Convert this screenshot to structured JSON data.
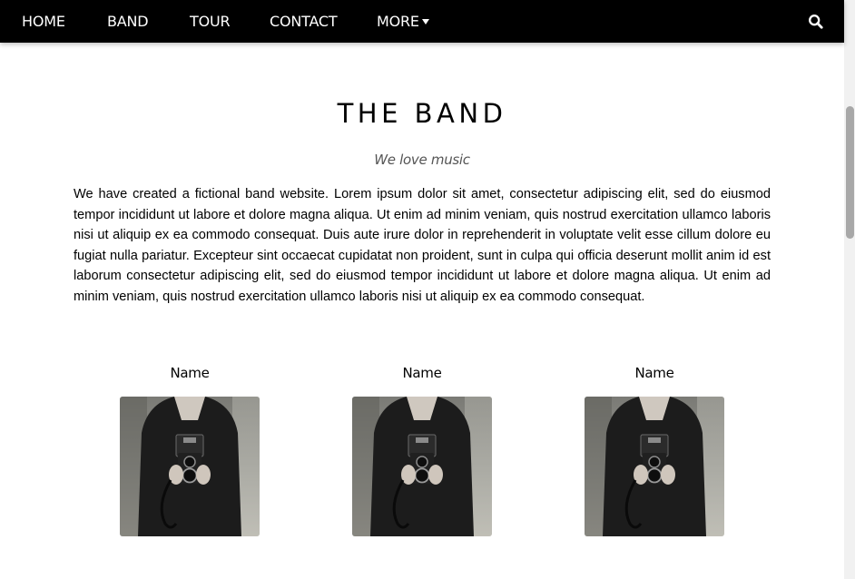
{
  "nav": {
    "items": [
      {
        "label": "HOME"
      },
      {
        "label": "BAND"
      },
      {
        "label": "TOUR"
      },
      {
        "label": "CONTACT"
      },
      {
        "label": "MORE"
      }
    ],
    "search_icon": "search-icon",
    "caret_icon": "caret-down-icon"
  },
  "band_section": {
    "title": "THE BAND",
    "subtitle": "We love music",
    "description": "We have created a fictional band website. Lorem ipsum dolor sit amet, consectetur adipiscing elit, sed do eiusmod tempor incididunt ut labore et dolore magna aliqua. Ut enim ad minim veniam, quis nostrud exercitation ullamco laboris nisi ut aliquip ex ea commodo consequat. Duis aute irure dolor in reprehenderit in voluptate velit esse cillum dolore eu fugiat nulla pariatur. Excepteur sint occaecat cupidatat non proident, sunt in culpa qui officia deserunt mollit anim id est laborum consectetur adipiscing elit, sed do eiusmod tempor incididunt ut labore et dolore magna aliqua. Ut enim ad minim veniam, quis nostrud exercitation ullamco laboris nisi ut aliquip ex ea commodo consequat.",
    "members": [
      {
        "name": "Name",
        "photo": "person-holding-camera"
      },
      {
        "name": "Name",
        "photo": "person-holding-camera"
      },
      {
        "name": "Name",
        "photo": "person-holding-camera"
      }
    ]
  },
  "colors": {
    "navbar_bg": "#000000",
    "navbar_text": "#ffffff",
    "subtitle": "#555555"
  }
}
